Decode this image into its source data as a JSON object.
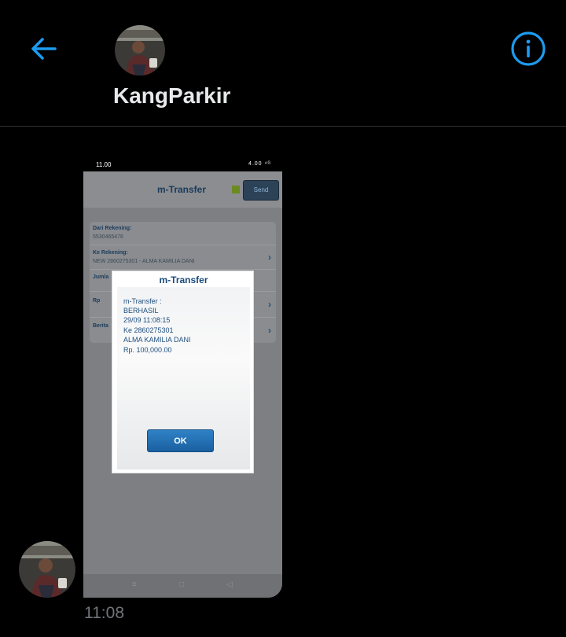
{
  "header": {
    "contact_name": "KangParkir",
    "back_icon": "arrow-left-icon",
    "info_icon": "info-icon",
    "accent_color": "#1d9bf0"
  },
  "message": {
    "time": "11:08",
    "screenshot": {
      "status_time": "11.00",
      "status_icons": "4.00 ⁴ᴳ",
      "app_title": "m-Transfer",
      "send_label": "Send",
      "form": [
        {
          "label": "Dari Rekening:",
          "value": "5530465476"
        },
        {
          "label": "Ke Rekening:",
          "value": "NEW 2860275301 - ALMA KAMILIA DANI"
        },
        {
          "label": "Jumla",
          "value": ""
        },
        {
          "label": "Rp",
          "value": ""
        },
        {
          "label": "Berita",
          "value": ""
        }
      ],
      "dialog": {
        "title": "m-Transfer",
        "lines": [
          "m-Transfer :",
          "BERHASIL",
          "29/09 11:08:15",
          "Ke 2860275301",
          "ALMA KAMILIA DANI",
          "Rp. 100,000.00"
        ],
        "ok_label": "OK"
      },
      "nav": {
        "menu": "≡",
        "home": "□",
        "back": "◁"
      }
    }
  }
}
